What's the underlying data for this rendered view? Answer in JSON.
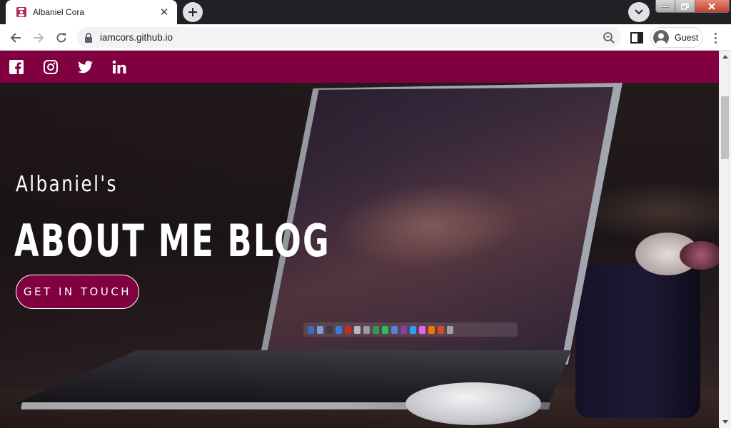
{
  "browser": {
    "tab": {
      "title": "Albaniel Cora",
      "favicon": "profile-favicon-icon"
    },
    "new_tab_icon": "plus-icon",
    "tab_search_icon": "chevron-down-icon",
    "window_controls": [
      "minimize-icon",
      "restore-icon",
      "close-icon"
    ],
    "url": "iamcors.github.io",
    "profile": {
      "label": "Guest"
    },
    "colors": {
      "frame": "#202124",
      "toolbar": "#ffffff",
      "omnibox": "#f1f3f4"
    }
  },
  "page": {
    "social_links": [
      {
        "name": "facebook-icon"
      },
      {
        "name": "instagram-icon"
      },
      {
        "name": "twitter-icon"
      },
      {
        "name": "linkedin-icon"
      }
    ],
    "hero": {
      "subtitle": "Albaniel's",
      "title": "ABOUT ME BLOG",
      "cta_label": "GET IN TOUCH"
    },
    "colors": {
      "accent": "#800040",
      "text": "#ffffff"
    }
  }
}
